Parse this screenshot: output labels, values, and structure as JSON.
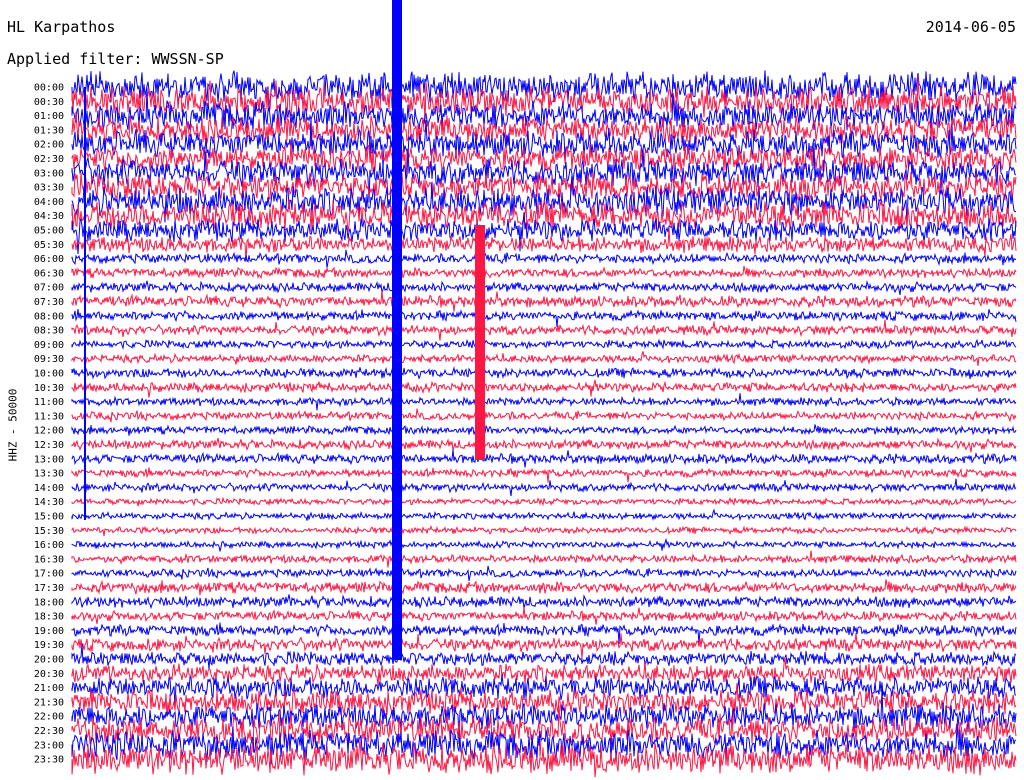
{
  "header": {
    "station": "HL Karpathos",
    "date": "2014-06-05",
    "filter_label": "Applied filter: WWSSN-SP"
  },
  "axis": {
    "ylabel": "HHZ - 50000"
  },
  "colors": {
    "trace_a": "#0000ff",
    "trace_b": "#ff1744",
    "background": "#ffffff",
    "text": "#000000"
  },
  "chart_data": {
    "type": "line",
    "title": "HL Karpathos",
    "subtitle": "Applied filter: WWSSN-SP",
    "ylabel": "HHZ - 50000",
    "grid": false,
    "legend": "none",
    "row_labels": [
      "00:00",
      "00:30",
      "01:00",
      "01:30",
      "02:00",
      "02:30",
      "03:00",
      "03:30",
      "04:00",
      "04:30",
      "05:00",
      "05:30",
      "06:00",
      "06:30",
      "07:00",
      "07:30",
      "08:00",
      "08:30",
      "09:00",
      "09:30",
      "10:00",
      "10:30",
      "11:00",
      "11:30",
      "12:00",
      "12:30",
      "13:00",
      "13:30",
      "14:00",
      "14:30",
      "15:00",
      "15:30",
      "16:00",
      "16:30",
      "17:00",
      "17:30",
      "18:00",
      "18:30",
      "19:00",
      "19:30",
      "20:00",
      "20:30",
      "21:00",
      "21:30",
      "22:00",
      "22:30",
      "23:00",
      "23:30"
    ],
    "series_colors": [
      "#0000ff",
      "#ff1744"
    ],
    "row_noise_level": [
      0.95,
      0.9,
      0.9,
      0.85,
      0.85,
      0.8,
      0.85,
      0.85,
      0.9,
      0.9,
      0.7,
      0.5,
      0.3,
      0.3,
      0.3,
      0.35,
      0.3,
      0.3,
      0.25,
      0.25,
      0.3,
      0.3,
      0.25,
      0.25,
      0.25,
      0.3,
      0.3,
      0.25,
      0.25,
      0.2,
      0.2,
      0.2,
      0.2,
      0.25,
      0.25,
      0.35,
      0.35,
      0.3,
      0.35,
      0.4,
      0.45,
      0.55,
      0.7,
      0.75,
      0.8,
      0.85,
      0.9,
      0.95
    ]
  }
}
